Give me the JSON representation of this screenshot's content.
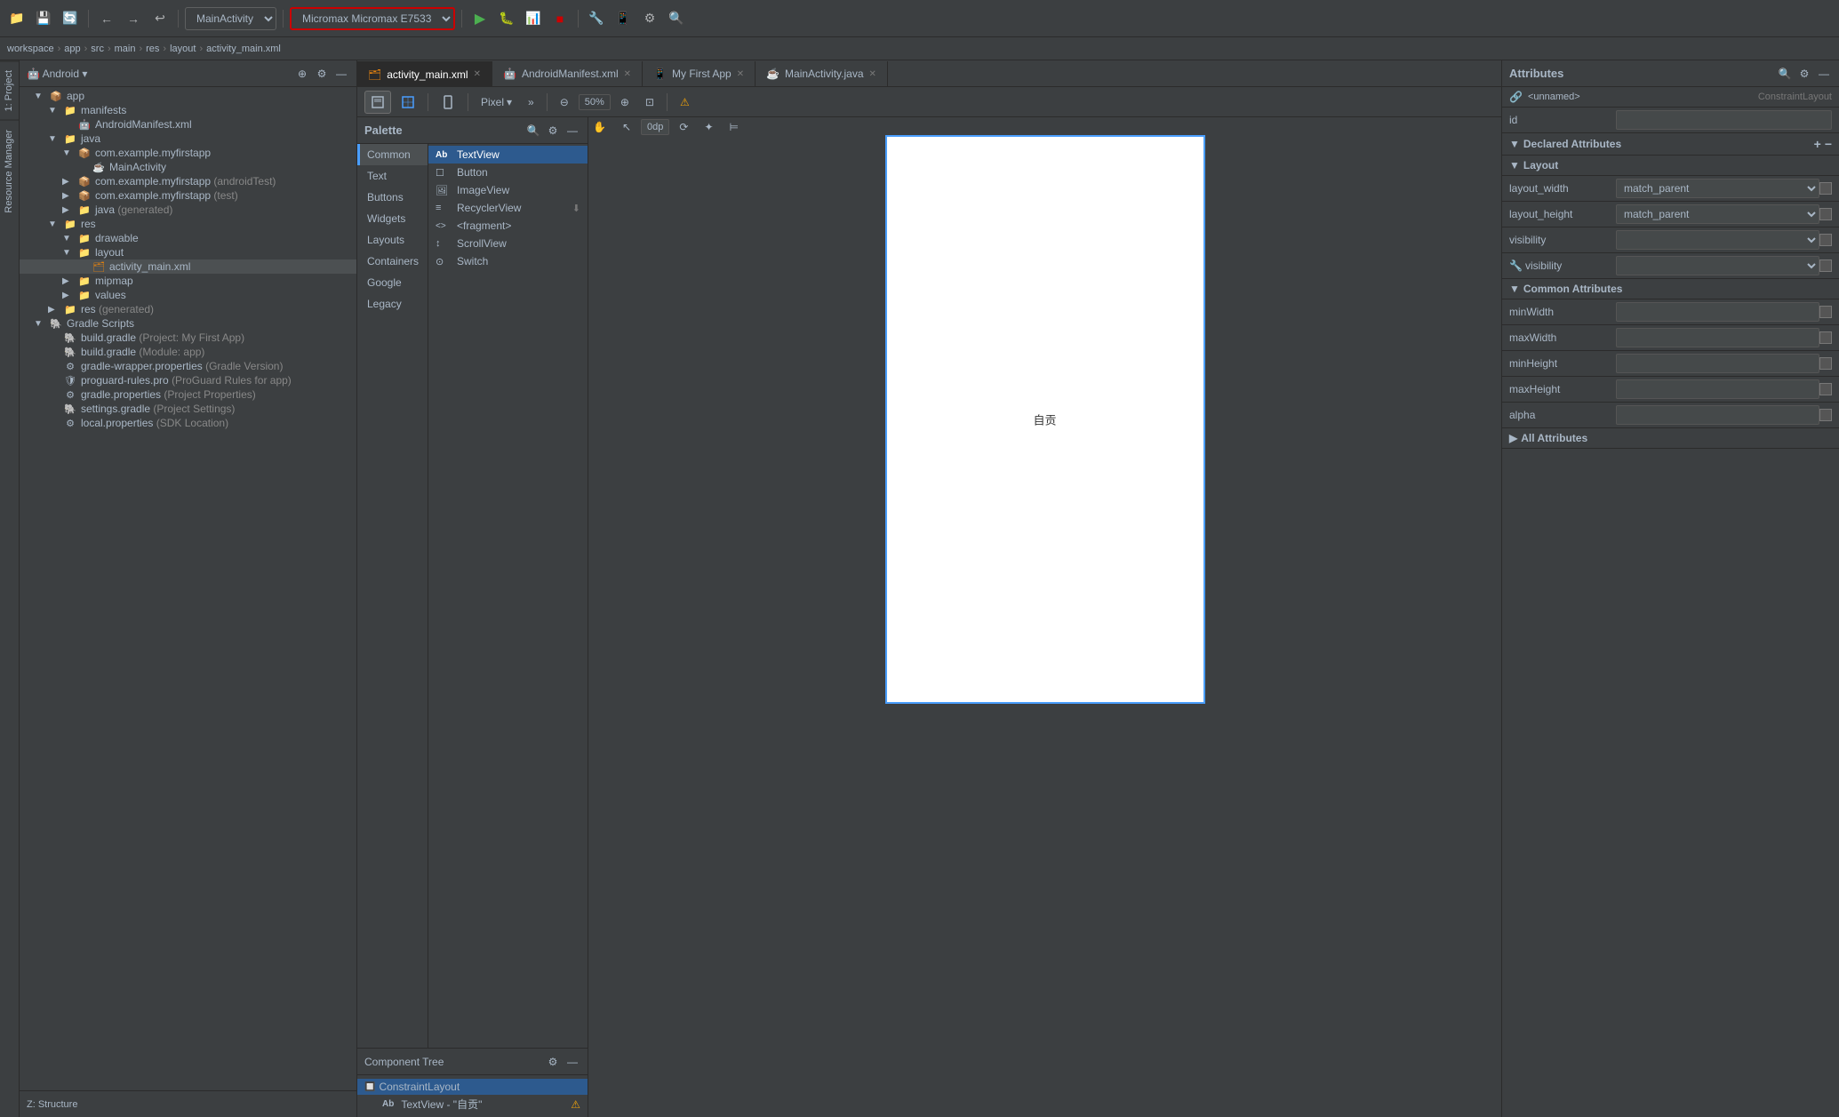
{
  "toolbar": {
    "main_activity_label": "MainActivity",
    "device_label": "Micromax Micromax E7533",
    "run_icon": "▶",
    "back_icon": "←",
    "forward_icon": "→"
  },
  "breadcrumb": {
    "items": [
      "workspace",
      "app",
      "src",
      "main",
      "res",
      "layout",
      "activity_main.xml"
    ]
  },
  "tabs": [
    {
      "label": "activity_main.xml",
      "icon": "🗂",
      "active": true
    },
    {
      "label": "AndroidManifest.xml",
      "icon": "🤖",
      "active": false
    },
    {
      "label": "My First App",
      "icon": "📱",
      "active": false
    },
    {
      "label": "MainActivity.java",
      "icon": "☕",
      "active": false
    }
  ],
  "project_panel": {
    "title": "Android",
    "items": [
      {
        "label": "app",
        "type": "folder",
        "indent": 1,
        "expanded": true
      },
      {
        "label": "manifests",
        "type": "folder",
        "indent": 2,
        "expanded": true
      },
      {
        "label": "AndroidManifest.xml",
        "type": "manifest",
        "indent": 3
      },
      {
        "label": "java",
        "type": "folder",
        "indent": 2,
        "expanded": true
      },
      {
        "label": "com.example.myfirstapp",
        "type": "package",
        "indent": 3,
        "expanded": true
      },
      {
        "label": "MainActivity",
        "type": "class",
        "indent": 4
      },
      {
        "label": "com.example.myfirstapp (androidTest)",
        "type": "package",
        "indent": 3,
        "expanded": false
      },
      {
        "label": "com.example.myfirstapp (test)",
        "type": "package",
        "indent": 3,
        "expanded": false
      },
      {
        "label": "java (generated)",
        "type": "folder",
        "indent": 3
      },
      {
        "label": "res",
        "type": "folder",
        "indent": 2,
        "expanded": true
      },
      {
        "label": "drawable",
        "type": "folder",
        "indent": 3,
        "expanded": true
      },
      {
        "label": "layout",
        "type": "folder",
        "indent": 3,
        "expanded": true
      },
      {
        "label": "activity_main.xml",
        "type": "layout",
        "indent": 4
      },
      {
        "label": "mipmap",
        "type": "folder",
        "indent": 3
      },
      {
        "label": "values",
        "type": "folder",
        "indent": 3
      },
      {
        "label": "res (generated)",
        "type": "folder",
        "indent": 2
      },
      {
        "label": "Gradle Scripts",
        "type": "folder",
        "indent": 1,
        "expanded": true
      },
      {
        "label": "build.gradle (Project: My First App)",
        "type": "gradle",
        "indent": 2
      },
      {
        "label": "build.gradle (Module: app)",
        "type": "gradle",
        "indent": 2
      },
      {
        "label": "gradle-wrapper.properties (Gradle Version)",
        "type": "properties",
        "indent": 2
      },
      {
        "label": "proguard-rules.pro (ProGuard Rules for app)",
        "type": "proguard",
        "indent": 2
      },
      {
        "label": "gradle.properties (Project Properties)",
        "type": "properties",
        "indent": 2
      },
      {
        "label": "settings.gradle (Project Settings)",
        "type": "gradle",
        "indent": 2
      },
      {
        "label": "local.properties (SDK Location)",
        "type": "properties",
        "indent": 2
      }
    ]
  },
  "palette": {
    "title": "Palette",
    "categories": [
      "Common",
      "Text",
      "Buttons",
      "Widgets",
      "Layouts",
      "Containers",
      "Google",
      "Legacy"
    ],
    "active_category": "Common",
    "items": [
      {
        "label": "TextView",
        "icon": "Ab"
      },
      {
        "label": "Button",
        "icon": "☐"
      },
      {
        "label": "ImageView",
        "icon": "🖼"
      },
      {
        "label": "RecyclerView",
        "icon": "≡"
      },
      {
        "label": "<fragment>",
        "icon": "<>"
      },
      {
        "label": "ScrollView",
        "icon": "↕"
      },
      {
        "label": "Switch",
        "icon": "⊙"
      }
    ]
  },
  "component_tree": {
    "title": "Component Tree",
    "items": [
      {
        "label": "ConstraintLayout",
        "indent": 0,
        "icon": "🔲"
      },
      {
        "label": "TextView - \"自贡\"",
        "indent": 1,
        "icon": "Ab",
        "warning": true
      }
    ]
  },
  "attributes": {
    "title": "Attributes",
    "class_name": "<unnamed>",
    "class_type": "ConstraintLayout",
    "id_label": "id",
    "id_value": "",
    "sections": {
      "declared": {
        "title": "Declared Attributes",
        "fields": []
      },
      "layout": {
        "title": "Layout",
        "fields": [
          {
            "label": "layout_width",
            "value": "match_parent",
            "type": "select"
          },
          {
            "label": "layout_height",
            "value": "match_parent",
            "type": "select"
          },
          {
            "label": "visibility",
            "value": "",
            "type": "select"
          },
          {
            "label": "visibility",
            "value": "",
            "type": "select",
            "icon": "🔧"
          }
        ]
      },
      "common": {
        "title": "Common Attributes",
        "fields": [
          {
            "label": "minWidth",
            "value": ""
          },
          {
            "label": "maxWidth",
            "value": ""
          },
          {
            "label": "minHeight",
            "value": ""
          },
          {
            "label": "maxHeight",
            "value": ""
          },
          {
            "label": "alpha",
            "value": ""
          }
        ]
      },
      "all": {
        "title": "All Attributes"
      }
    }
  },
  "canvas": {
    "text": "自贡",
    "zoom": "50%",
    "device": "Pixel"
  },
  "design_toolbar": {
    "view_mode": "Design",
    "blueprint_mode": "Blueprint",
    "orientation": "Portrait",
    "device": "Pixel",
    "zoom_out": "-",
    "zoom_level": "50%",
    "zoom_in": "+",
    "force_refresh": "↺",
    "warning_icon": "⚠",
    "constraint": "0dp",
    "magic_wand": "✦",
    "align": "⊨"
  },
  "left_sidebar": {
    "tabs": [
      "1: Project",
      "Resource Manager"
    ]
  },
  "bottom_left_tab": "Z: Structure"
}
